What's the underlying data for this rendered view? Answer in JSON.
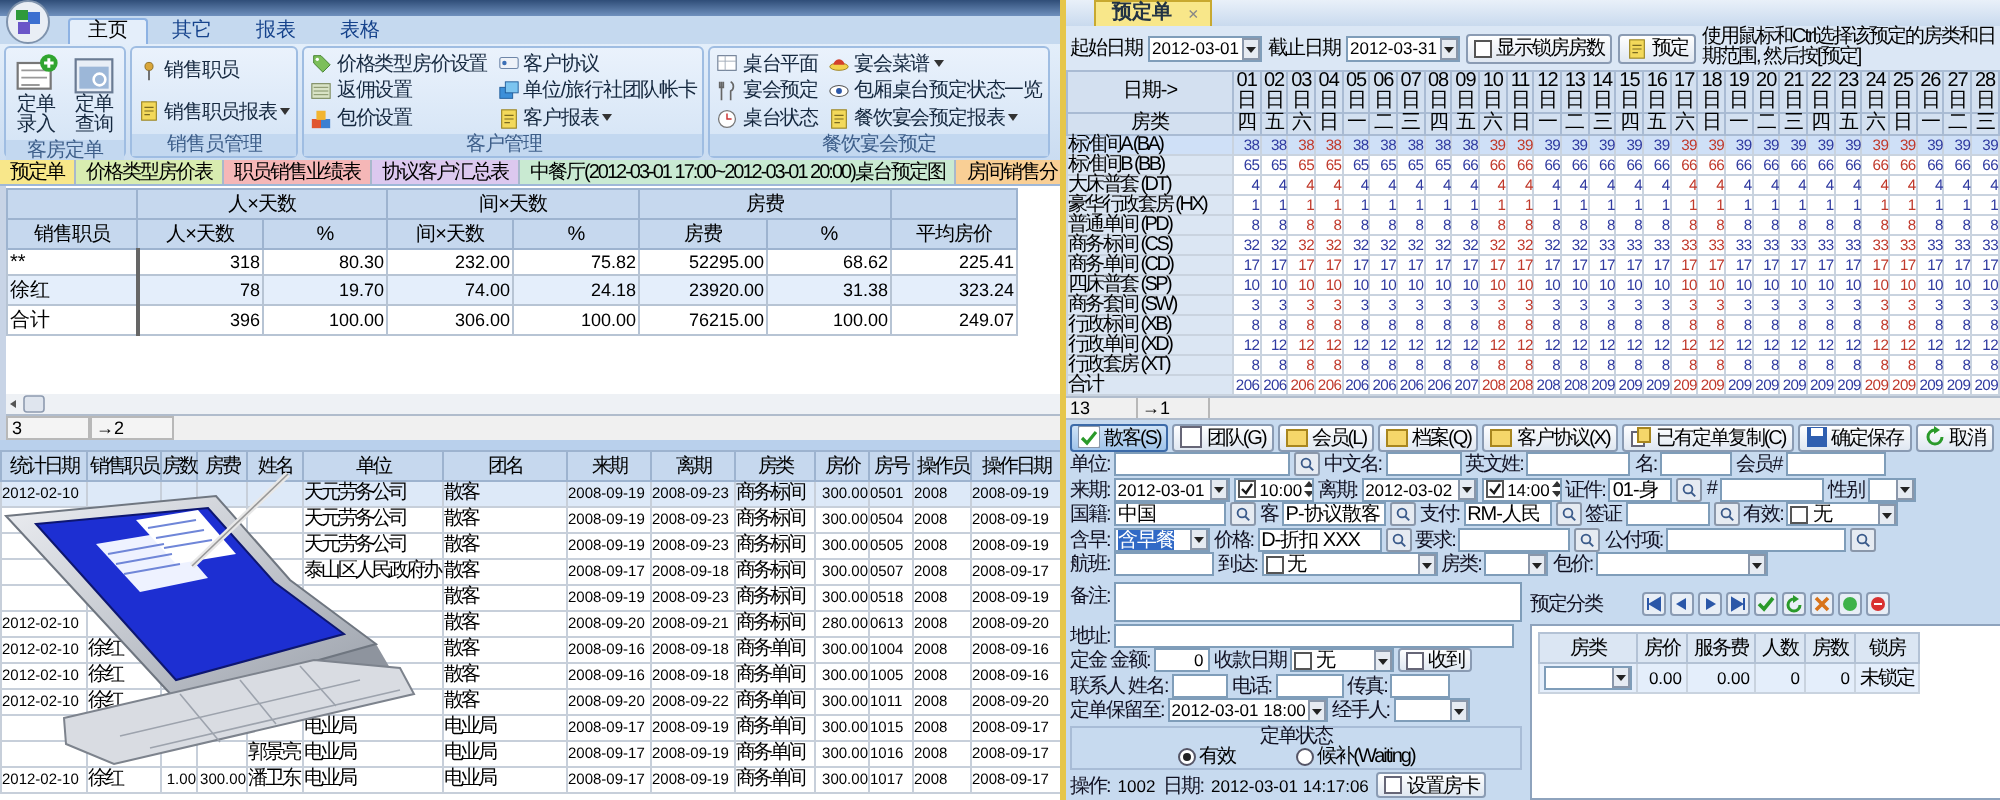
{
  "ribbon": {
    "tabs": [
      {
        "label": "主页",
        "selected": true
      },
      {
        "label": "其它",
        "selected": false
      },
      {
        "label": "报表",
        "selected": false
      },
      {
        "label": "表格",
        "selected": false
      }
    ],
    "groups": [
      {
        "title": "客房定单",
        "kind": "large",
        "columns": [
          [
            {
              "label": "定单录入",
              "dropdown": false
            }
          ],
          [
            {
              "label": "定单查询",
              "dropdown": false
            }
          ]
        ]
      },
      {
        "title": "销售员管理",
        "kind": "small",
        "columns": [
          [
            {
              "label": "销售职员",
              "dropdown": false
            },
            {
              "label": "销售职员报表",
              "dropdown": true
            }
          ]
        ]
      },
      {
        "title": "客户管理",
        "kind": "small",
        "columns": [
          [
            {
              "label": "价格类型房价设置",
              "dropdown": false
            },
            {
              "label": "返佣设置",
              "dropdown": false
            },
            {
              "label": "包价设置",
              "dropdown": false
            }
          ],
          [
            {
              "label": "客户协议",
              "dropdown": false
            },
            {
              "label": "单位/旅行社团队帐卡",
              "dropdown": false
            },
            {
              "label": "客户报表",
              "dropdown": true
            }
          ]
        ]
      },
      {
        "title": "餐饮宴会预定",
        "kind": "small",
        "columns": [
          [
            {
              "label": "桌台平面",
              "dropdown": false
            },
            {
              "label": "宴会预定",
              "dropdown": false
            },
            {
              "label": "桌台状态",
              "dropdown": false
            }
          ],
          [
            {
              "label": "宴会菜谱",
              "dropdown": true
            },
            {
              "label": "包厢桌台预定状态一览",
              "dropdown": false
            },
            {
              "label": "餐饮宴会预定报表",
              "dropdown": true
            }
          ]
        ]
      }
    ]
  },
  "document_tabs": [
    {
      "label": "预定单",
      "color": "#f8e78a"
    },
    {
      "label": "价格类型房价表",
      "color": "#d8ecb0"
    },
    {
      "label": "职员销售业绩表",
      "color": "#f5b7b7"
    },
    {
      "label": "协议客户汇总表",
      "color": "#dcc8ef"
    },
    {
      "label": "中餐厅(2012-03-01 17:00~2012-03-01 20:00)桌台预定图",
      "color": "#c9ead2"
    },
    {
      "label": "房间销售分",
      "color": "#f9cf95"
    }
  ],
  "summary_report": {
    "group_headers": [
      "人×天数",
      "间×天数",
      "房费"
    ],
    "columns": [
      "销售职员",
      "人×天数",
      "%",
      "间×天数",
      "%",
      "房费",
      "%",
      "平均房价"
    ],
    "rows": [
      [
        "**",
        "318",
        "80.30",
        "232.00",
        "75.82",
        "52295.00",
        "68.62",
        "225.41"
      ],
      [
        "徐红",
        "78",
        "19.70",
        "74.00",
        "24.18",
        "23920.00",
        "31.38",
        "323.24"
      ],
      [
        "合计",
        "396",
        "100.00",
        "306.00",
        "100.00",
        "76215.00",
        "100.00",
        "249.07"
      ]
    ],
    "status": {
      "count": "3",
      "position": "→2"
    }
  },
  "detail_report": {
    "columns": [
      "统计日期",
      "销售职员",
      "房数",
      "房费",
      "姓名",
      "单位",
      "团名",
      "来期",
      "离期",
      "房类",
      "房价",
      "房号",
      "操作员",
      "操作日期"
    ],
    "rows": [
      [
        "2012-02-10",
        null,
        null,
        null,
        null,
        "天元劳务公司",
        "散客",
        "2008-09-19",
        "2008-09-23",
        "商务标间",
        "300.00",
        "0501",
        "2008",
        "2008-09-19"
      ],
      [
        null,
        null,
        null,
        null,
        null,
        "天元劳务公司",
        "散客",
        "2008-09-19",
        "2008-09-23",
        "商务标间",
        "300.00",
        "0504",
        "2008",
        "2008-09-19"
      ],
      [
        null,
        null,
        null,
        null,
        null,
        "天元劳务公司",
        "散客",
        "2008-09-19",
        "2008-09-23",
        "商务标间",
        "300.00",
        "0505",
        "2008",
        "2008-09-19"
      ],
      [
        null,
        null,
        null,
        null,
        null,
        "泰山区人民政府办",
        "散客",
        "2008-09-17",
        "2008-09-18",
        "商务标间",
        "300.00",
        "0507",
        "2008",
        "2008-09-17"
      ],
      [
        null,
        null,
        null,
        null,
        null,
        null,
        "散客",
        "2008-09-19",
        "2008-09-23",
        "商务标间",
        "300.00",
        "0518",
        "2008",
        "2008-09-19"
      ],
      [
        "2012-02-10",
        null,
        null,
        null,
        null,
        null,
        "散客",
        "2008-09-20",
        "2008-09-21",
        "商务标间",
        "280.00",
        "0613",
        "2008",
        "2008-09-20"
      ],
      [
        "2012-02-10",
        "徐红",
        null,
        null,
        null,
        null,
        "散客",
        "2008-09-16",
        "2008-09-18",
        "商务单间",
        "300.00",
        "1004",
        "2008",
        "2008-09-16"
      ],
      [
        "2012-02-10",
        "徐红",
        null,
        null,
        null,
        null,
        "散客",
        "2008-09-16",
        "2008-09-18",
        "商务单间",
        "300.00",
        "1005",
        "2008",
        "2008-09-16"
      ],
      [
        "2012-02-10",
        "徐红",
        null,
        null,
        null,
        null,
        "散客",
        "2008-09-20",
        "2008-09-22",
        "商务单间",
        "300.00",
        "1011",
        "2008",
        "2008-09-20"
      ],
      [
        null,
        null,
        null,
        null,
        null,
        "电业局",
        "电业局",
        "2008-09-17",
        "2008-09-19",
        "商务单间",
        "300.00",
        "1015",
        "2008",
        "2008-09-17"
      ],
      [
        null,
        null,
        null,
        null,
        "郭景亮",
        "电业局",
        "电业局",
        "2008-09-17",
        "2008-09-19",
        "商务单间",
        "300.00",
        "1016",
        "2008",
        "2008-09-17"
      ],
      [
        "2012-02-10",
        "徐红",
        "1.00",
        "300.00",
        "潘卫东",
        "电业局",
        "电业局",
        "2008-09-17",
        "2008-09-19",
        "商务单间",
        "300.00",
        "1017",
        "2008",
        "2008-09-17"
      ]
    ]
  },
  "booking": {
    "tab": {
      "label": "预定单",
      "close": "×"
    },
    "start_label": "起始日期",
    "start_date": "2012-03-01",
    "end_label": "截止日期",
    "end_date": "2012-03-31",
    "show_locked": {
      "label": "显示锁房房数",
      "checked": false
    },
    "book_button": "预定",
    "hint": "使用鼠标和Ctrl选择该预定的房类和日期范围, 然后按[预定]",
    "corner_labels": [
      "日期->",
      "房类"
    ],
    "days": [
      {
        "day": "01日",
        "weekday": "四",
        "weekend": false
      },
      {
        "day": "02日",
        "weekday": "五",
        "weekend": false
      },
      {
        "day": "03日",
        "weekday": "六",
        "weekend": true
      },
      {
        "day": "04日",
        "weekday": "日",
        "weekend": true
      },
      {
        "day": "05日",
        "weekday": "一",
        "weekend": false
      },
      {
        "day": "06日",
        "weekday": "二",
        "weekend": false
      },
      {
        "day": "07日",
        "weekday": "三",
        "weekend": false
      },
      {
        "day": "08日",
        "weekday": "四",
        "weekend": false
      },
      {
        "day": "09日",
        "weekday": "五",
        "weekend": false
      },
      {
        "day": "10日",
        "weekday": "六",
        "weekend": true
      },
      {
        "day": "11日",
        "weekday": "日",
        "weekend": true
      },
      {
        "day": "12日",
        "weekday": "一",
        "weekend": false
      },
      {
        "day": "13日",
        "weekday": "二",
        "weekend": false
      },
      {
        "day": "14日",
        "weekday": "三",
        "weekend": false
      },
      {
        "day": "15日",
        "weekday": "四",
        "weekend": false
      },
      {
        "day": "16日",
        "weekday": "五",
        "weekend": false
      },
      {
        "day": "17日",
        "weekday": "六",
        "weekend": true
      },
      {
        "day": "18日",
        "weekday": "日",
        "weekend": true
      },
      {
        "day": "19日",
        "weekday": "一",
        "weekend": false
      },
      {
        "day": "20日",
        "weekday": "二",
        "weekend": false
      },
      {
        "day": "21日",
        "weekday": "三",
        "weekend": false
      },
      {
        "day": "22日",
        "weekday": "四",
        "weekend": false
      },
      {
        "day": "23日",
        "weekday": "五",
        "weekend": false
      },
      {
        "day": "24日",
        "weekday": "六",
        "weekend": true
      },
      {
        "day": "25日",
        "weekday": "日",
        "weekend": true
      },
      {
        "day": "26日",
        "weekday": "一",
        "weekend": false
      },
      {
        "day": "27日",
        "weekday": "二",
        "weekend": false
      },
      {
        "day": "28日",
        "weekday": "三",
        "weekend": false
      }
    ],
    "rows": [
      {
        "room": "标准间A (BA)",
        "selected": true,
        "counts": [
          "38",
          "38",
          "38",
          "38",
          "38",
          "38",
          "38",
          "38",
          "38",
          "39",
          "39",
          "39",
          "39",
          "39",
          "39",
          "39",
          "39",
          "39",
          "39",
          "39",
          "39",
          "39",
          "39",
          "39",
          "39",
          "39",
          "39",
          "39"
        ]
      },
      {
        "room": "标准间B (BB)",
        "selected": false,
        "counts": [
          "65",
          "65",
          "65",
          "65",
          "65",
          "65",
          "65",
          "65",
          "66",
          "66",
          "66",
          "66",
          "66",
          "66",
          "66",
          "66",
          "66",
          "66",
          "66",
          "66",
          "66",
          "66",
          "66",
          "66",
          "66",
          "66",
          "66",
          "66"
        ]
      },
      {
        "room": "大床普套 (DT)",
        "selected": false,
        "counts": [
          "4",
          "4",
          "4",
          "4",
          "4",
          "4",
          "4",
          "4",
          "4",
          "4",
          "4",
          "4",
          "4",
          "4",
          "4",
          "4",
          "4",
          "4",
          "4",
          "4",
          "4",
          "4",
          "4",
          "4",
          "4",
          "4",
          "4",
          "4"
        ]
      },
      {
        "room": "豪华行政套房 (HX)",
        "selected": false,
        "counts": [
          "1",
          "1",
          "1",
          "1",
          "1",
          "1",
          "1",
          "1",
          "1",
          "1",
          "1",
          "1",
          "1",
          "1",
          "1",
          "1",
          "1",
          "1",
          "1",
          "1",
          "1",
          "1",
          "1",
          "1",
          "1",
          "1",
          "1",
          "1"
        ]
      },
      {
        "room": "普通单间 (PD)",
        "selected": false,
        "counts": [
          "8",
          "8",
          "8",
          "8",
          "8",
          "8",
          "8",
          "8",
          "8",
          "8",
          "8",
          "8",
          "8",
          "8",
          "8",
          "8",
          "8",
          "8",
          "8",
          "8",
          "8",
          "8",
          "8",
          "8",
          "8",
          "8",
          "8",
          "8"
        ]
      },
      {
        "room": "商务标间 (CS)",
        "selected": false,
        "counts": [
          "32",
          "32",
          "32",
          "32",
          "32",
          "32",
          "32",
          "32",
          "32",
          "32",
          "32",
          "32",
          "32",
          "33",
          "33",
          "33",
          "33",
          "33",
          "33",
          "33",
          "33",
          "33",
          "33",
          "33",
          "33",
          "33",
          "33",
          "33"
        ]
      },
      {
        "room": "商务单间 (CD)",
        "selected": false,
        "counts": [
          "17",
          "17",
          "17",
          "17",
          "17",
          "17",
          "17",
          "17",
          "17",
          "17",
          "17",
          "17",
          "17",
          "17",
          "17",
          "17",
          "17",
          "17",
          "17",
          "17",
          "17",
          "17",
          "17",
          "17",
          "17",
          "17",
          "17",
          "17"
        ]
      },
      {
        "room": "四床普套 (SP)",
        "selected": false,
        "counts": [
          "10",
          "10",
          "10",
          "10",
          "10",
          "10",
          "10",
          "10",
          "10",
          "10",
          "10",
          "10",
          "10",
          "10",
          "10",
          "10",
          "10",
          "10",
          "10",
          "10",
          "10",
          "10",
          "10",
          "10",
          "10",
          "10",
          "10",
          "10"
        ]
      },
      {
        "room": "商务套间 (SW)",
        "selected": false,
        "counts": [
          "3",
          "3",
          "3",
          "3",
          "3",
          "3",
          "3",
          "3",
          "3",
          "3",
          "3",
          "3",
          "3",
          "3",
          "3",
          "3",
          "3",
          "3",
          "3",
          "3",
          "3",
          "3",
          "3",
          "3",
          "3",
          "3",
          "3",
          "3"
        ]
      },
      {
        "room": "行政标间 (XB)",
        "selected": false,
        "counts": [
          "8",
          "8",
          "8",
          "8",
          "8",
          "8",
          "8",
          "8",
          "8",
          "8",
          "8",
          "8",
          "8",
          "8",
          "8",
          "8",
          "8",
          "8",
          "8",
          "8",
          "8",
          "8",
          "8",
          "8",
          "8",
          "8",
          "8",
          "8"
        ]
      },
      {
        "room": "行政单间 (XD)",
        "selected": false,
        "counts": [
          "12",
          "12",
          "12",
          "12",
          "12",
          "12",
          "12",
          "12",
          "12",
          "12",
          "12",
          "12",
          "12",
          "12",
          "12",
          "12",
          "12",
          "12",
          "12",
          "12",
          "12",
          "12",
          "12",
          "12",
          "12",
          "12",
          "12",
          "12"
        ]
      },
      {
        "room": "行政套房 (XT)",
        "selected": false,
        "counts": [
          "8",
          "8",
          "8",
          "8",
          "8",
          "8",
          "8",
          "8",
          "8",
          "8",
          "8",
          "8",
          "8",
          "8",
          "8",
          "8",
          "8",
          "8",
          "8",
          "8",
          "8",
          "8",
          "8",
          "8",
          "8",
          "8",
          "8",
          "8"
        ]
      }
    ],
    "total": {
      "label": "合计",
      "counts": [
        "206",
        "206",
        "206",
        "206",
        "206",
        "206",
        "206",
        "206",
        "207",
        "208",
        "208",
        "208",
        "208",
        "209",
        "209",
        "209",
        "209",
        "209",
        "209",
        "209",
        "209",
        "209",
        "209",
        "209",
        "209",
        "209",
        "209",
        "209"
      ]
    },
    "status": {
      "count": "13",
      "position": "→1"
    }
  },
  "form": {
    "type_buttons": [
      {
        "label": "散客(S)",
        "selected": true
      },
      {
        "label": "团队(G)",
        "selected": false
      },
      {
        "label": "会员(L)",
        "selected": false
      },
      {
        "label": "档案(Q)",
        "selected": false
      },
      {
        "label": "客户协议(X)",
        "selected": false
      }
    ],
    "actions": [
      {
        "label": "已有定单复制(C)"
      },
      {
        "label": "确定保存"
      },
      {
        "label": "取消"
      }
    ],
    "rows": [
      {
        "items": [
          {
            "kind": "label",
            "text": "单位:"
          },
          {
            "kind": "field"
          },
          {
            "kind": "lookup"
          },
          {
            "kind": "label",
            "text": "中文名:"
          },
          {
            "kind": "field"
          },
          {
            "kind": "label",
            "text": "英文姓:"
          },
          {
            "kind": "field"
          },
          {
            "kind": "label",
            "text": "名:"
          },
          {
            "kind": "field"
          },
          {
            "kind": "label",
            "text": "会员#"
          },
          {
            "kind": "field"
          }
        ]
      },
      {
        "items": [
          {
            "kind": "label",
            "text": "来期:"
          },
          {
            "kind": "date",
            "value": "2012-03-01"
          },
          {
            "kind": "time",
            "value": "10:00",
            "checked": true
          },
          {
            "kind": "label",
            "text": "离期:"
          },
          {
            "kind": "date",
            "value": "2012-03-02"
          },
          {
            "kind": "time",
            "value": "14:00",
            "checked": true
          },
          {
            "kind": "label",
            "text": "证件:"
          },
          {
            "kind": "field",
            "value": "01-身"
          },
          {
            "kind": "lookup"
          },
          {
            "kind": "label",
            "text": "#"
          },
          {
            "kind": "field"
          },
          {
            "kind": "label",
            "text": "性别"
          },
          {
            "kind": "combo"
          }
        ]
      },
      {
        "items": [
          {
            "kind": "label",
            "text": "国籍:"
          },
          {
            "kind": "field",
            "value": "中国"
          },
          {
            "kind": "lookup"
          },
          {
            "kind": "label",
            "text": "客"
          },
          {
            "kind": "field",
            "value": "P-协议散客"
          },
          {
            "kind": "lookup"
          },
          {
            "kind": "label",
            "text": "支付:"
          },
          {
            "kind": "field",
            "value": "RM-人民"
          },
          {
            "kind": "lookup"
          },
          {
            "kind": "label",
            "text": "签证"
          },
          {
            "kind": "field"
          },
          {
            "kind": "lookup"
          },
          {
            "kind": "label",
            "text": "有效:"
          },
          {
            "kind": "checkcombo",
            "value": "无",
            "checked": false
          }
        ]
      },
      {
        "items": [
          {
            "kind": "label",
            "text": "含早:"
          },
          {
            "kind": "combo",
            "value": "含早餐",
            "highlighted": true
          },
          {
            "kind": "label",
            "text": "价格:"
          },
          {
            "kind": "field",
            "value": "D-折扣 XXX"
          },
          {
            "kind": "lookup"
          },
          {
            "kind": "label",
            "text": "要求:"
          },
          {
            "kind": "field"
          },
          {
            "kind": "lookup"
          },
          {
            "kind": "label",
            "text": "公付项:"
          },
          {
            "kind": "field"
          },
          {
            "kind": "lookup"
          }
        ]
      },
      {
        "items": [
          {
            "kind": "label",
            "text": "航班:"
          },
          {
            "kind": "field"
          },
          {
            "kind": "label",
            "text": "到达:"
          },
          {
            "kind": "checkcombo",
            "value": "无",
            "checked": false
          },
          {
            "kind": "label",
            "text": "房类:"
          },
          {
            "kind": "combo"
          },
          {
            "kind": "label",
            "text": "包价:"
          },
          {
            "kind": "combo"
          }
        ]
      }
    ],
    "remarks_label": "备注:",
    "address_label": "地址:",
    "deposit": {
      "title": "定金",
      "amount_label": "金额:",
      "amount": "0",
      "date_label": "收款日期",
      "date_value": "无",
      "date_checked": false,
      "received": "收到"
    },
    "contact": {
      "title": "联系人",
      "name_label": "姓名:",
      "phone_label": "电话:",
      "fax_label": "传真:"
    },
    "hold": {
      "label": "定单保留至:",
      "value": "2012-03-01 18:00",
      "handler_label": "经手人:"
    },
    "status": {
      "title": "定单状态",
      "options": [
        {
          "label": "有效",
          "selected": true
        },
        {
          "label": "候补(Waiting)",
          "selected": false
        }
      ]
    },
    "footer": {
      "operator_label": "操作:",
      "operator": "1002",
      "date_label": "日期:",
      "date": "2012-03-01 14:17:06",
      "room_card": "设置房卡"
    },
    "category": {
      "label": "预定分类",
      "columns": [
        "房类",
        "房价",
        "服务费",
        "人数",
        "房数",
        "锁房"
      ],
      "row": [
        "0.00",
        "0.00",
        "0",
        "0",
        "未锁定"
      ]
    }
  }
}
